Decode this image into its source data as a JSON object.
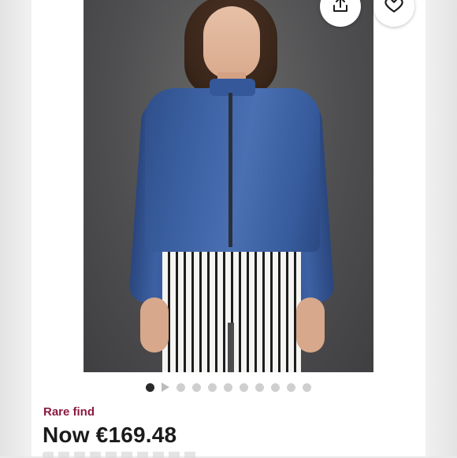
{
  "listing": {
    "badge": "Rare find",
    "price": "Now €169.48"
  },
  "actions": {
    "share_icon": "share-icon",
    "like_icon": "heart-icon"
  },
  "carousel": {
    "total_slides": 11,
    "active_index": 0,
    "video_slide_index": 1
  },
  "colors": {
    "badge": "#8b1a3f",
    "price": "#1b1b1b",
    "dot_active": "#2a2a2a",
    "dot_inactive": "#cfcfcf"
  }
}
